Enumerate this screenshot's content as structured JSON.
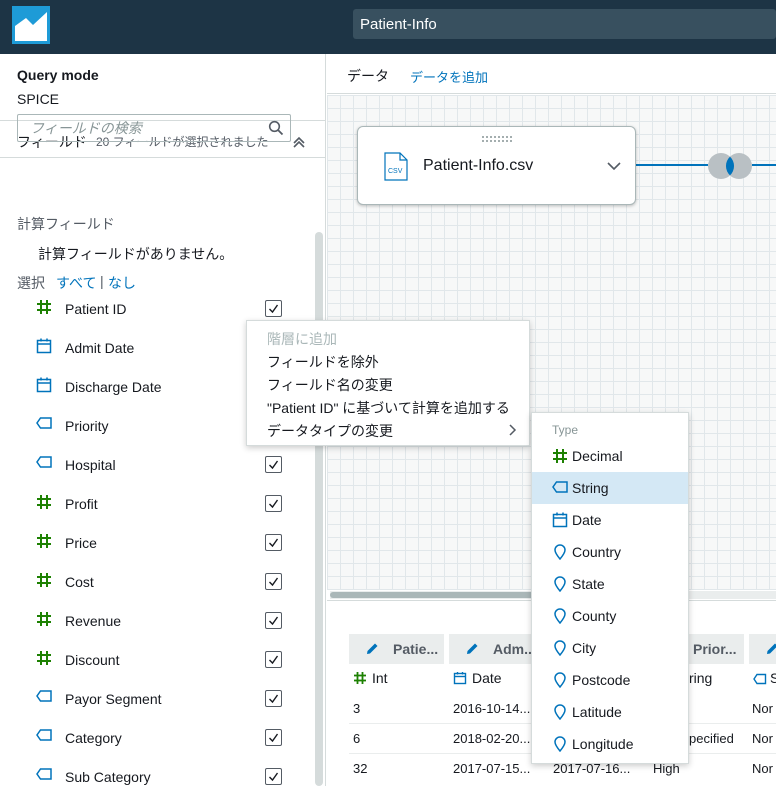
{
  "header": {
    "title": "Patient-Info"
  },
  "left": {
    "query_mode_label": "Query mode",
    "query_mode_value": "SPICE",
    "fields_label": "フィールド",
    "fields_count": "20 フィールドが選択されました",
    "search_placeholder": "フィールドの検索",
    "calc_label": "計算フィールド",
    "calc_empty": "計算フィールドがありません。",
    "select_label": "選択",
    "select_all": "すべて",
    "select_sep": "|",
    "select_none": "なし",
    "fields": [
      {
        "name": "Patient ID",
        "type": "number",
        "checked": true
      },
      {
        "name": "Admit Date",
        "type": "date",
        "checked": true
      },
      {
        "name": "Discharge Date",
        "type": "date",
        "checked": true
      },
      {
        "name": "Priority",
        "type": "string",
        "checked": true
      },
      {
        "name": "Hospital",
        "type": "string",
        "checked": true
      },
      {
        "name": "Profit",
        "type": "number",
        "checked": true
      },
      {
        "name": "Price",
        "type": "number",
        "checked": true
      },
      {
        "name": "Cost",
        "type": "number",
        "checked": true
      },
      {
        "name": "Revenue",
        "type": "number",
        "checked": true
      },
      {
        "name": "Discount",
        "type": "number",
        "checked": true
      },
      {
        "name": "Payor Segment",
        "type": "string",
        "checked": true
      },
      {
        "name": "Category",
        "type": "string",
        "checked": true
      },
      {
        "name": "Sub Category",
        "type": "string",
        "checked": true
      }
    ]
  },
  "main": {
    "data_label": "データ",
    "add_data": "データを追加",
    "card_file": "Patient-Info.csv",
    "card_icon_text": "CSV"
  },
  "table": {
    "headers": [
      "Patie...",
      "Adm...",
      "Prior..."
    ],
    "types": [
      "Int",
      "Date",
      "ring",
      "S"
    ],
    "rows": [
      [
        "3",
        "2016-10-14...",
        "",
        "Nor"
      ],
      [
        "6",
        "2018-02-20...",
        "pecified",
        "Nor"
      ],
      [
        "32",
        "2017-07-15...",
        "2017-07-16...",
        "High",
        "Nor"
      ]
    ]
  },
  "context_menu": {
    "items": [
      {
        "label": "階層に追加",
        "disabled": true
      },
      {
        "label": "フィールドを除外",
        "disabled": false
      },
      {
        "label": "フィールド名の変更",
        "disabled": false
      },
      {
        "label": "\"Patient ID\" に基づいて計算を追加する",
        "disabled": false
      },
      {
        "label": "データタイプの変更",
        "disabled": false
      }
    ]
  },
  "submenu": {
    "title": "Type",
    "items": [
      {
        "label": "Decimal",
        "icon": "number-icon",
        "selected": false
      },
      {
        "label": "String",
        "icon": "string-icon",
        "selected": true
      },
      {
        "label": "Date",
        "icon": "calendar-icon",
        "selected": false
      },
      {
        "label": "Country",
        "icon": "location-pin-icon",
        "selected": false
      },
      {
        "label": "State",
        "icon": "location-pin-icon",
        "selected": false
      },
      {
        "label": "County",
        "icon": "location-pin-icon",
        "selected": false
      },
      {
        "label": "City",
        "icon": "location-pin-icon",
        "selected": false
      },
      {
        "label": "Postcode",
        "icon": "location-pin-icon",
        "selected": false
      },
      {
        "label": "Latitude",
        "icon": "location-pin-icon",
        "selected": false
      },
      {
        "label": "Longitude",
        "icon": "location-pin-icon",
        "selected": false
      }
    ]
  },
  "colors": {
    "accent": "#0073bb",
    "number_green": "#1d8102",
    "header_bg": "#1d3445",
    "selected_bg": "#d4e8f5"
  }
}
